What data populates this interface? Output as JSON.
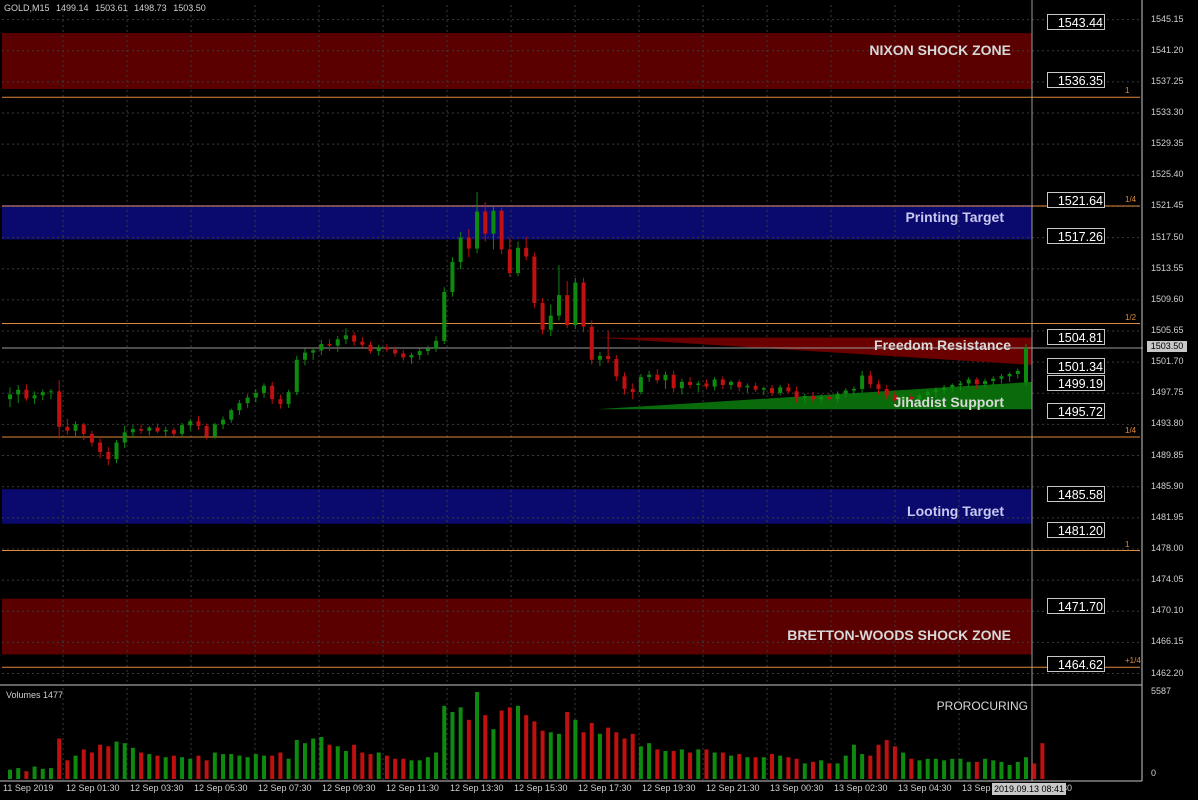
{
  "header": {
    "symbol": "GOLD,M15",
    "open": "1499.14",
    "high": "1503.61",
    "low": "1498.73",
    "close": "1503.50"
  },
  "colors": {
    "bull": "#0e8a0e",
    "bear": "#c01010",
    "shock_zone": "#5a0000",
    "target_zone": "#0a0a6e",
    "fib": "#e08a3c",
    "grid": "#3a3a3a"
  },
  "zones": [
    {
      "name": "NIXON SHOCK ZONE",
      "top": 1543.44,
      "bottom": 1536.35,
      "kind": "shock"
    },
    {
      "name": "Printing Target",
      "top": 1521.64,
      "bottom": 1517.26,
      "kind": "target"
    },
    {
      "name": "Looting Target",
      "top": 1485.58,
      "bottom": 1481.2,
      "kind": "target"
    },
    {
      "name": "BRETTON-WOODS SHOCK ZONE",
      "top": 1471.7,
      "bottom": 1464.62,
      "kind": "shock"
    }
  ],
  "labels": {
    "nixon": "NIXON SHOCK ZONE",
    "printing": "Printing Target",
    "freedom": "Freedom Resistance",
    "jihadist": "Jihadist Support",
    "looting": "Looting Target",
    "bretton": "BRETTON-WOODS SHOCK ZONE"
  },
  "price_boxes": [
    "1543.44",
    "1536.35",
    "1521.64",
    "1517.26",
    "1504.81",
    "1501.34",
    "1499.19",
    "1495.72",
    "1485.58",
    "1481.20",
    "1471.70",
    "1464.62"
  ],
  "price_axis": [
    "1545.15",
    "1541.20",
    "1537.25",
    "1533.30",
    "1529.35",
    "1525.40",
    "1521.45",
    "1517.50",
    "1513.55",
    "1509.60",
    "1505.65",
    "1501.70",
    "1497.75",
    "1493.80",
    "1489.85",
    "1485.90",
    "1481.95",
    "1478.00",
    "1474.05",
    "1470.10",
    "1466.15",
    "1462.20"
  ],
  "fib_levels": [
    {
      "label": "1",
      "price": 1535.3
    },
    {
      "label": "1/4",
      "price": 1521.5
    },
    {
      "label": "1/2",
      "price": 1506.6
    },
    {
      "label": "1/4",
      "price": 1492.2
    },
    {
      "label": "1",
      "price": 1477.8
    },
    {
      "label": "+1/4",
      "price": 1463.0
    }
  ],
  "current_price": "1503.50",
  "time_labels": [
    "11 Sep 2019",
    "12 Sep 01:30",
    "12 Sep 03:30",
    "12 Sep 05:30",
    "12 Sep 07:30",
    "12 Sep 09:30",
    "12 Sep 11:30",
    "12 Sep 13:30",
    "12 Sep 15:30",
    "12 Sep 17:30",
    "12 Sep 19:30",
    "12 Sep 21:30",
    "13 Sep 00:30",
    "13 Sep 02:30",
    "13 Sep 04:30",
    "13 Sep",
    "30"
  ],
  "current_time": "2019.09.13 08:41",
  "volume_panel": {
    "title": "Volumes 1477",
    "indicator_name": "PROROCURING",
    "axis_max": "5587",
    "axis_min": "0"
  },
  "chart_data": {
    "type": "candlestick",
    "title": "GOLD,M15",
    "ylim": [
      1461.0,
      1547.0
    ],
    "candles": [
      {
        "o": 1497.0,
        "h": 1498.5,
        "l": 1496.0,
        "c": 1497.6
      },
      {
        "o": 1497.6,
        "h": 1498.8,
        "l": 1496.5,
        "c": 1498.2
      },
      {
        "o": 1498.2,
        "h": 1498.9,
        "l": 1496.8,
        "c": 1497.1
      },
      {
        "o": 1497.1,
        "h": 1498.0,
        "l": 1496.4,
        "c": 1497.5
      },
      {
        "o": 1497.5,
        "h": 1498.2,
        "l": 1496.9,
        "c": 1497.9
      },
      {
        "o": 1497.9,
        "h": 1498.3,
        "l": 1497.0,
        "c": 1498.0
      },
      {
        "o": 1498.0,
        "h": 1499.4,
        "l": 1492.0,
        "c": 1493.5
      },
      {
        "o": 1493.5,
        "h": 1494.5,
        "l": 1492.5,
        "c": 1493.0
      },
      {
        "o": 1493.0,
        "h": 1494.2,
        "l": 1492.1,
        "c": 1493.8
      },
      {
        "o": 1493.8,
        "h": 1494.0,
        "l": 1491.8,
        "c": 1492.6
      },
      {
        "o": 1492.6,
        "h": 1493.0,
        "l": 1491.0,
        "c": 1491.5
      },
      {
        "o": 1491.5,
        "h": 1492.0,
        "l": 1489.5,
        "c": 1490.3
      },
      {
        "o": 1490.3,
        "h": 1490.9,
        "l": 1488.6,
        "c": 1489.4
      },
      {
        "o": 1489.4,
        "h": 1491.8,
        "l": 1488.9,
        "c": 1491.5
      },
      {
        "o": 1491.5,
        "h": 1493.6,
        "l": 1490.8,
        "c": 1492.8
      },
      {
        "o": 1492.8,
        "h": 1493.7,
        "l": 1492.1,
        "c": 1493.2
      },
      {
        "o": 1493.2,
        "h": 1493.8,
        "l": 1492.6,
        "c": 1493.0
      },
      {
        "o": 1493.0,
        "h": 1493.6,
        "l": 1492.4,
        "c": 1493.4
      },
      {
        "o": 1493.4,
        "h": 1493.9,
        "l": 1492.7,
        "c": 1492.9
      },
      {
        "o": 1492.9,
        "h": 1493.5,
        "l": 1492.2,
        "c": 1493.1
      },
      {
        "o": 1493.1,
        "h": 1493.4,
        "l": 1492.3,
        "c": 1492.6
      },
      {
        "o": 1492.6,
        "h": 1494.0,
        "l": 1492.2,
        "c": 1493.7
      },
      {
        "o": 1493.7,
        "h": 1494.5,
        "l": 1493.0,
        "c": 1494.2
      },
      {
        "o": 1494.2,
        "h": 1494.9,
        "l": 1493.1,
        "c": 1493.6
      },
      {
        "o": 1493.6,
        "h": 1493.9,
        "l": 1491.9,
        "c": 1492.3
      },
      {
        "o": 1492.3,
        "h": 1494.0,
        "l": 1492.0,
        "c": 1493.8
      },
      {
        "o": 1493.8,
        "h": 1494.8,
        "l": 1493.2,
        "c": 1494.4
      },
      {
        "o": 1494.4,
        "h": 1495.8,
        "l": 1494.0,
        "c": 1495.6
      },
      {
        "o": 1495.6,
        "h": 1496.9,
        "l": 1495.0,
        "c": 1496.5
      },
      {
        "o": 1496.5,
        "h": 1497.6,
        "l": 1495.9,
        "c": 1497.2
      },
      {
        "o": 1497.2,
        "h": 1498.3,
        "l": 1496.6,
        "c": 1497.8
      },
      {
        "o": 1497.8,
        "h": 1499.0,
        "l": 1497.2,
        "c": 1498.7
      },
      {
        "o": 1498.7,
        "h": 1499.2,
        "l": 1496.4,
        "c": 1497.0
      },
      {
        "o": 1497.0,
        "h": 1497.6,
        "l": 1495.8,
        "c": 1496.4
      },
      {
        "o": 1496.4,
        "h": 1498.2,
        "l": 1495.9,
        "c": 1497.9
      },
      {
        "o": 1497.9,
        "h": 1502.5,
        "l": 1497.5,
        "c": 1502.0
      },
      {
        "o": 1502.0,
        "h": 1503.4,
        "l": 1501.3,
        "c": 1502.9
      },
      {
        "o": 1502.9,
        "h": 1503.6,
        "l": 1502.0,
        "c": 1503.2
      },
      {
        "o": 1503.2,
        "h": 1504.5,
        "l": 1502.6,
        "c": 1504.0
      },
      {
        "o": 1504.0,
        "h": 1504.6,
        "l": 1503.1,
        "c": 1503.8
      },
      {
        "o": 1503.8,
        "h": 1505.0,
        "l": 1503.0,
        "c": 1504.6
      },
      {
        "o": 1504.6,
        "h": 1506.0,
        "l": 1504.0,
        "c": 1505.1
      },
      {
        "o": 1505.1,
        "h": 1505.5,
        "l": 1503.8,
        "c": 1504.3
      },
      {
        "o": 1504.3,
        "h": 1504.9,
        "l": 1503.6,
        "c": 1503.9
      },
      {
        "o": 1503.9,
        "h": 1504.3,
        "l": 1502.8,
        "c": 1503.1
      },
      {
        "o": 1503.1,
        "h": 1503.9,
        "l": 1502.5,
        "c": 1503.6
      },
      {
        "o": 1503.6,
        "h": 1504.0,
        "l": 1503.0,
        "c": 1503.3
      },
      {
        "o": 1503.3,
        "h": 1503.7,
        "l": 1502.4,
        "c": 1502.8
      },
      {
        "o": 1502.8,
        "h": 1503.2,
        "l": 1501.9,
        "c": 1502.3
      },
      {
        "o": 1502.3,
        "h": 1502.9,
        "l": 1501.5,
        "c": 1502.6
      },
      {
        "o": 1502.6,
        "h": 1503.4,
        "l": 1502.0,
        "c": 1503.1
      },
      {
        "o": 1503.1,
        "h": 1503.8,
        "l": 1502.6,
        "c": 1503.4
      },
      {
        "o": 1503.4,
        "h": 1505.0,
        "l": 1503.0,
        "c": 1504.4
      },
      {
        "o": 1504.4,
        "h": 1511.2,
        "l": 1504.0,
        "c": 1510.6
      },
      {
        "o": 1510.6,
        "h": 1515.0,
        "l": 1510.0,
        "c": 1514.4
      },
      {
        "o": 1514.4,
        "h": 1518.2,
        "l": 1513.5,
        "c": 1517.5
      },
      {
        "o": 1517.5,
        "h": 1518.6,
        "l": 1515.0,
        "c": 1516.1
      },
      {
        "o": 1516.1,
        "h": 1523.3,
        "l": 1515.5,
        "c": 1520.8
      },
      {
        "o": 1520.8,
        "h": 1522.0,
        "l": 1517.0,
        "c": 1518.0
      },
      {
        "o": 1518.0,
        "h": 1521.4,
        "l": 1516.0,
        "c": 1520.9
      },
      {
        "o": 1520.9,
        "h": 1521.3,
        "l": 1515.4,
        "c": 1516.0
      },
      {
        "o": 1516.0,
        "h": 1517.4,
        "l": 1512.5,
        "c": 1513.0
      },
      {
        "o": 1513.0,
        "h": 1517.0,
        "l": 1512.6,
        "c": 1516.2
      },
      {
        "o": 1516.2,
        "h": 1517.6,
        "l": 1514.6,
        "c": 1515.1
      },
      {
        "o": 1515.1,
        "h": 1515.6,
        "l": 1508.6,
        "c": 1509.2
      },
      {
        "o": 1509.2,
        "h": 1509.8,
        "l": 1505.2,
        "c": 1505.8
      },
      {
        "o": 1505.8,
        "h": 1509.0,
        "l": 1505.0,
        "c": 1507.6
      },
      {
        "o": 1507.6,
        "h": 1514.0,
        "l": 1507.0,
        "c": 1510.2
      },
      {
        "o": 1510.2,
        "h": 1512.0,
        "l": 1506.0,
        "c": 1506.4
      },
      {
        "o": 1506.4,
        "h": 1512.4,
        "l": 1505.9,
        "c": 1511.8
      },
      {
        "o": 1511.8,
        "h": 1512.4,
        "l": 1505.5,
        "c": 1506.2
      },
      {
        "o": 1506.2,
        "h": 1507.0,
        "l": 1501.4,
        "c": 1502.0
      },
      {
        "o": 1502.0,
        "h": 1503.0,
        "l": 1501.2,
        "c": 1502.5
      },
      {
        "o": 1502.5,
        "h": 1505.6,
        "l": 1501.6,
        "c": 1502.1
      },
      {
        "o": 1502.1,
        "h": 1502.6,
        "l": 1499.3,
        "c": 1499.9
      },
      {
        "o": 1499.9,
        "h": 1500.4,
        "l": 1497.6,
        "c": 1498.3
      },
      {
        "o": 1498.3,
        "h": 1499.0,
        "l": 1497.0,
        "c": 1497.9
      },
      {
        "o": 1497.9,
        "h": 1500.2,
        "l": 1497.6,
        "c": 1499.8
      },
      {
        "o": 1499.8,
        "h": 1500.6,
        "l": 1499.2,
        "c": 1500.1
      },
      {
        "o": 1500.1,
        "h": 1500.8,
        "l": 1499.0,
        "c": 1499.4
      },
      {
        "o": 1499.4,
        "h": 1500.5,
        "l": 1498.3,
        "c": 1500.1
      },
      {
        "o": 1500.1,
        "h": 1500.6,
        "l": 1497.9,
        "c": 1498.4
      },
      {
        "o": 1498.4,
        "h": 1499.6,
        "l": 1497.6,
        "c": 1499.2
      },
      {
        "o": 1499.2,
        "h": 1499.8,
        "l": 1498.4,
        "c": 1498.8
      },
      {
        "o": 1498.8,
        "h": 1499.3,
        "l": 1497.9,
        "c": 1499.0
      },
      {
        "o": 1499.0,
        "h": 1499.5,
        "l": 1498.3,
        "c": 1498.6
      },
      {
        "o": 1498.6,
        "h": 1499.8,
        "l": 1498.1,
        "c": 1499.5
      },
      {
        "o": 1499.5,
        "h": 1499.9,
        "l": 1498.3,
        "c": 1498.8
      },
      {
        "o": 1498.8,
        "h": 1499.4,
        "l": 1498.2,
        "c": 1499.2
      },
      {
        "o": 1499.2,
        "h": 1499.5,
        "l": 1498.0,
        "c": 1498.5
      },
      {
        "o": 1498.5,
        "h": 1499.0,
        "l": 1497.8,
        "c": 1498.7
      },
      {
        "o": 1498.7,
        "h": 1499.1,
        "l": 1497.9,
        "c": 1498.2
      },
      {
        "o": 1498.2,
        "h": 1498.6,
        "l": 1497.5,
        "c": 1498.4
      },
      {
        "o": 1498.4,
        "h": 1498.8,
        "l": 1497.4,
        "c": 1497.8
      },
      {
        "o": 1497.8,
        "h": 1498.8,
        "l": 1497.5,
        "c": 1498.5
      },
      {
        "o": 1498.5,
        "h": 1499.0,
        "l": 1497.8,
        "c": 1498.0
      },
      {
        "o": 1498.0,
        "h": 1498.6,
        "l": 1496.6,
        "c": 1497.2
      },
      {
        "o": 1497.2,
        "h": 1497.7,
        "l": 1496.4,
        "c": 1497.4
      },
      {
        "o": 1497.4,
        "h": 1497.9,
        "l": 1496.6,
        "c": 1497.0
      },
      {
        "o": 1497.0,
        "h": 1497.6,
        "l": 1496.5,
        "c": 1497.3
      },
      {
        "o": 1497.3,
        "h": 1497.7,
        "l": 1496.7,
        "c": 1497.0
      },
      {
        "o": 1497.0,
        "h": 1498.0,
        "l": 1496.6,
        "c": 1497.7
      },
      {
        "o": 1497.7,
        "h": 1498.4,
        "l": 1497.2,
        "c": 1498.1
      },
      {
        "o": 1498.1,
        "h": 1498.6,
        "l": 1497.5,
        "c": 1498.3
      },
      {
        "o": 1498.3,
        "h": 1500.6,
        "l": 1497.8,
        "c": 1500.0
      },
      {
        "o": 1500.0,
        "h": 1500.6,
        "l": 1498.4,
        "c": 1498.9
      },
      {
        "o": 1498.9,
        "h": 1499.4,
        "l": 1497.6,
        "c": 1498.3
      },
      {
        "o": 1498.3,
        "h": 1498.8,
        "l": 1497.0,
        "c": 1497.5
      },
      {
        "o": 1497.5,
        "h": 1498.0,
        "l": 1496.6,
        "c": 1496.9
      },
      {
        "o": 1496.9,
        "h": 1497.6,
        "l": 1496.3,
        "c": 1497.3
      },
      {
        "o": 1497.3,
        "h": 1497.8,
        "l": 1496.6,
        "c": 1497.0
      },
      {
        "o": 1497.0,
        "h": 1497.7,
        "l": 1496.5,
        "c": 1497.5
      },
      {
        "o": 1497.5,
        "h": 1498.2,
        "l": 1497.0,
        "c": 1497.9
      },
      {
        "o": 1497.9,
        "h": 1498.5,
        "l": 1497.2,
        "c": 1498.2
      },
      {
        "o": 1498.2,
        "h": 1498.8,
        "l": 1497.6,
        "c": 1498.5
      },
      {
        "o": 1498.5,
        "h": 1499.0,
        "l": 1497.9,
        "c": 1498.8
      },
      {
        "o": 1498.8,
        "h": 1499.3,
        "l": 1498.1,
        "c": 1499.0
      },
      {
        "o": 1499.0,
        "h": 1499.8,
        "l": 1498.5,
        "c": 1499.5
      },
      {
        "o": 1499.5,
        "h": 1499.8,
        "l": 1498.3,
        "c": 1498.9
      },
      {
        "o": 1498.9,
        "h": 1499.6,
        "l": 1498.4,
        "c": 1499.3
      },
      {
        "o": 1499.3,
        "h": 1499.9,
        "l": 1498.7,
        "c": 1499.6
      },
      {
        "o": 1499.6,
        "h": 1500.2,
        "l": 1499.0,
        "c": 1499.9
      },
      {
        "o": 1499.9,
        "h": 1500.4,
        "l": 1499.2,
        "c": 1500.2
      },
      {
        "o": 1500.2,
        "h": 1500.9,
        "l": 1499.6,
        "c": 1500.6
      },
      {
        "o": 1499.1,
        "h": 1504.0,
        "l": 1498.7,
        "c": 1503.5
      }
    ],
    "volumes": [
      600,
      700,
      500,
      800,
      650,
      700,
      2600,
      1200,
      1500,
      1900,
      1700,
      2200,
      2100,
      2400,
      2300,
      2000,
      1700,
      1600,
      1500,
      1400,
      1500,
      1400,
      1300,
      1500,
      1200,
      1700,
      1600,
      1600,
      1500,
      1400,
      1600,
      1500,
      1500,
      1700,
      1300,
      2500,
      2300,
      2600,
      2700,
      2200,
      2100,
      1800,
      2200,
      1700,
      1600,
      1700,
      1500,
      1300,
      1300,
      1200,
      1200,
      1400,
      1700,
      4700,
      4300,
      4600,
      3800,
      5587,
      4100,
      3200,
      4400,
      4600,
      4700,
      4100,
      3700,
      3100,
      3000,
      2900,
      4300,
      3800,
      3000,
      3600,
      2900,
      3300,
      3000,
      2600,
      2900,
      2100,
      2300,
      1900,
      1800,
      1800,
      1900,
      1700,
      1900,
      1900,
      1700,
      1700,
      1500,
      1600,
      1400,
      1400,
      1400,
      1600,
      1500,
      1400,
      1300,
      1000,
      1100,
      1200,
      1000,
      1000,
      1500,
      2200,
      1600,
      1500,
      2200,
      2500,
      2100,
      1700,
      1300,
      1200,
      1300,
      1300,
      1200,
      1300,
      1300,
      1100,
      1100,
      1300,
      1200,
      1100,
      900,
      1100,
      1400,
      1000,
      2300
    ],
    "volume_colors": "bull/bear by candle direction"
  }
}
